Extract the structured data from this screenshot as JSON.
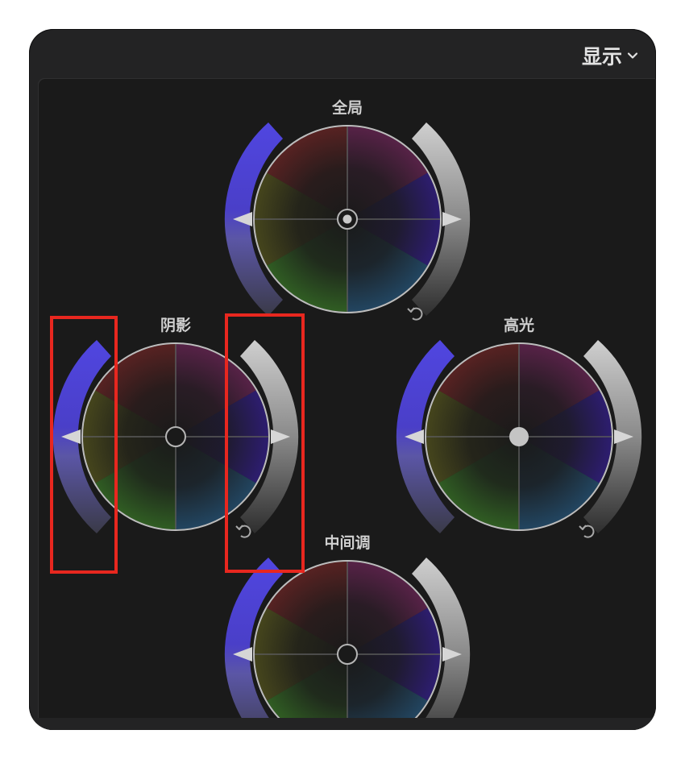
{
  "header": {
    "display_menu_label": "显示",
    "display_menu_icon": "chevron-down-icon"
  },
  "wheels": [
    {
      "id": "global",
      "label": "全局",
      "puck": "ring",
      "reset_icon": "undo-icon"
    },
    {
      "id": "shadows",
      "label": "阴影",
      "puck": "ring",
      "reset_icon": "undo-icon"
    },
    {
      "id": "highlights",
      "label": "高光",
      "puck": "filled",
      "reset_icon": "undo-icon"
    },
    {
      "id": "midtones",
      "label": "中间调",
      "puck": "ring",
      "reset_icon": "undo-icon"
    }
  ],
  "colors": {
    "window_bg": "#232324",
    "panel_bg": "#1a1a1a",
    "saturation_slider": "#4b3fd6",
    "brightness_slider": "#8a8a8a",
    "annotation_box": "#e8271f"
  }
}
